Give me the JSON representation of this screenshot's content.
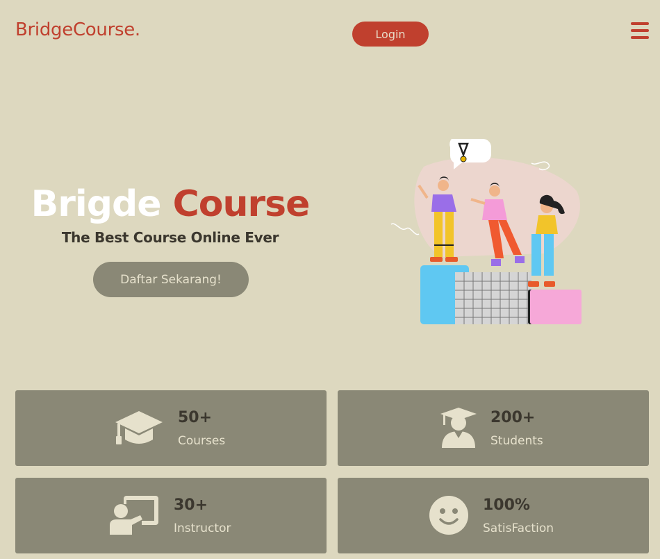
{
  "header": {
    "brand": "BridgeCourse.",
    "login_label": "Login",
    "menu_icon": "hamburger-icon"
  },
  "hero": {
    "title_part1": "Brigde",
    "title_part2": "Course",
    "subtitle": "The Best Course Online Ever",
    "cta_label": "Daftar Sekarang!",
    "illustration": "people-on-podium-illustration"
  },
  "stats": [
    {
      "icon": "graduation-cap-icon",
      "value": "50+",
      "label": "Courses"
    },
    {
      "icon": "student-icon",
      "value": "200+",
      "label": "Students"
    },
    {
      "icon": "instructor-icon",
      "value": "30+",
      "label": "Instructor"
    },
    {
      "icon": "smiley-icon",
      "value": "100%",
      "label": "SatisFaction"
    }
  ],
  "colors": {
    "background": "#ddd8bf",
    "accent": "#c0402e",
    "card": "#8a8876",
    "text_dark": "#3b372e",
    "text_light": "#e6e1cc"
  }
}
